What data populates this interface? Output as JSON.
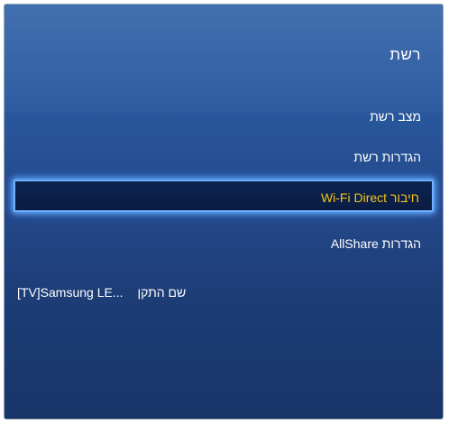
{
  "panel": {
    "title": "רשת"
  },
  "menu": {
    "items": [
      {
        "label": "מצב רשת"
      },
      {
        "label": "הגדרות רשת"
      },
      {
        "label": "חיבור Wi-Fi Direct"
      },
      {
        "label": "הגדרות AllShare"
      }
    ]
  },
  "device_name": {
    "label": "שם התקן",
    "value": "[TV]Samsung LE..."
  },
  "colors": {
    "background": "#24498a",
    "highlight_text": "#f4c417",
    "highlight_border": "#6fb0ff",
    "text": "#ffffff"
  }
}
